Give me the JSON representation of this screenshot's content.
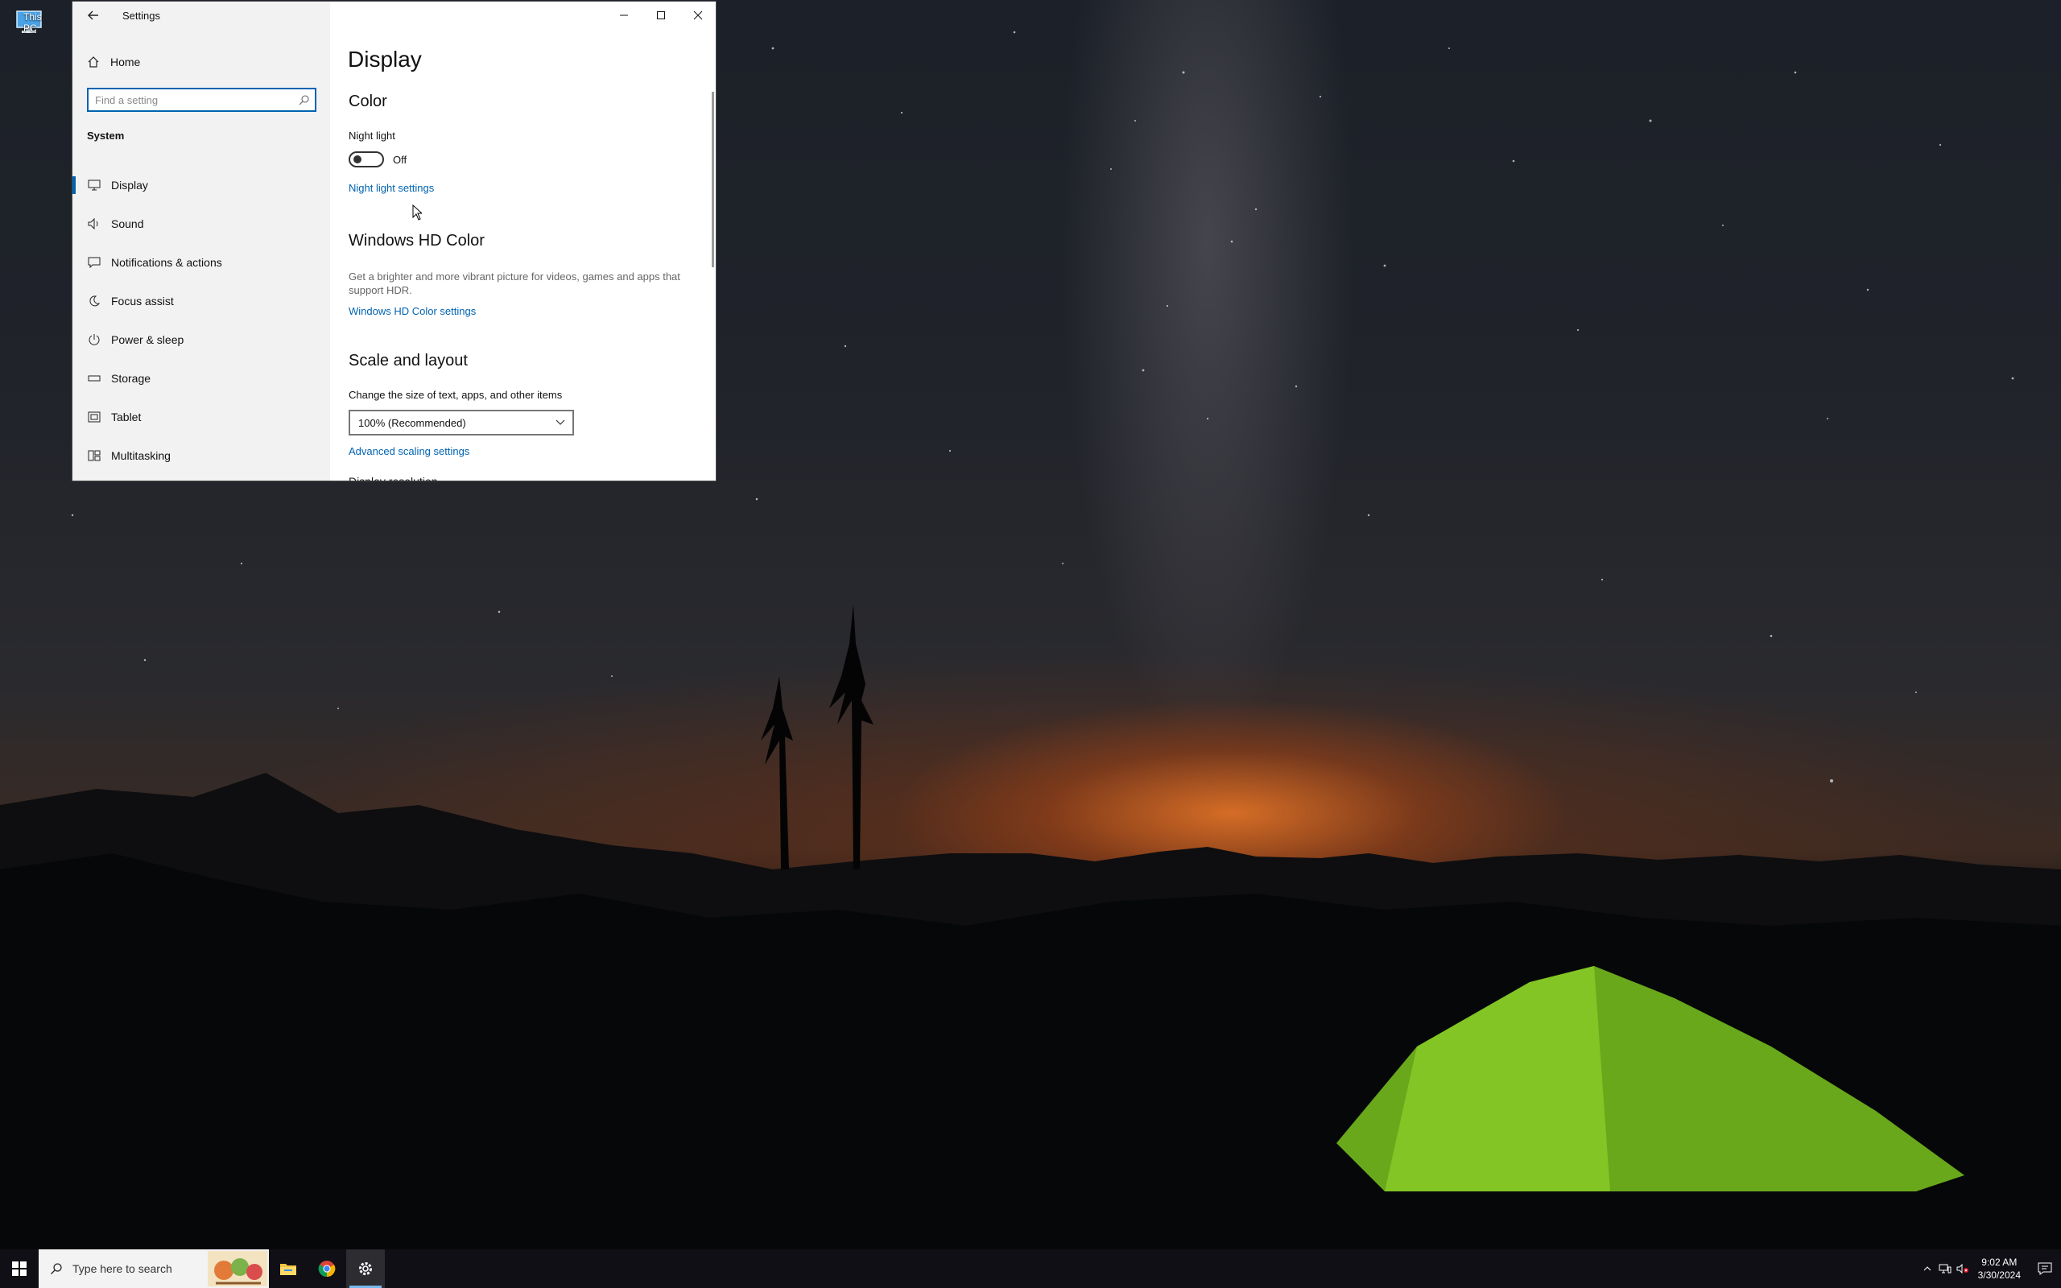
{
  "desktop": {
    "icons": [
      {
        "label": "This PC",
        "icon": "this-pc-icon"
      }
    ]
  },
  "window": {
    "title": "Settings",
    "controls": {
      "minimize": "minimize-icon",
      "maximize": "maximize-icon",
      "close": "close-icon"
    }
  },
  "sidebar": {
    "home": "Home",
    "search_placeholder": "Find a setting",
    "section": "System",
    "items": [
      {
        "label": "Display",
        "icon": "display-icon",
        "active": true
      },
      {
        "label": "Sound",
        "icon": "sound-icon"
      },
      {
        "label": "Notifications & actions",
        "icon": "notifications-icon"
      },
      {
        "label": "Focus assist",
        "icon": "focus-assist-icon"
      },
      {
        "label": "Power & sleep",
        "icon": "power-icon"
      },
      {
        "label": "Storage",
        "icon": "storage-icon"
      },
      {
        "label": "Tablet",
        "icon": "tablet-icon"
      },
      {
        "label": "Multitasking",
        "icon": "multitasking-icon"
      }
    ]
  },
  "content": {
    "page_title": "Display",
    "color": {
      "heading": "Color",
      "night_light_label": "Night light",
      "night_light_state": "Off",
      "night_light_link": "Night light settings"
    },
    "hd_color": {
      "heading": "Windows HD Color",
      "description": "Get a brighter and more vibrant picture for videos, games and apps that support HDR.",
      "link": "Windows HD Color settings"
    },
    "scale": {
      "heading": "Scale and layout",
      "label": "Change the size of text, apps, and other items",
      "selected": "100% (Recommended)",
      "link": "Advanced scaling settings"
    },
    "cut_off_heading": "Display resolution"
  },
  "taskbar": {
    "search_text": "Type here to search",
    "apps": [
      "file-explorer-icon",
      "chrome-icon",
      "settings-icon"
    ],
    "time": "9:02 AM",
    "date": "3/30/2024",
    "accent": "#0063b1"
  }
}
